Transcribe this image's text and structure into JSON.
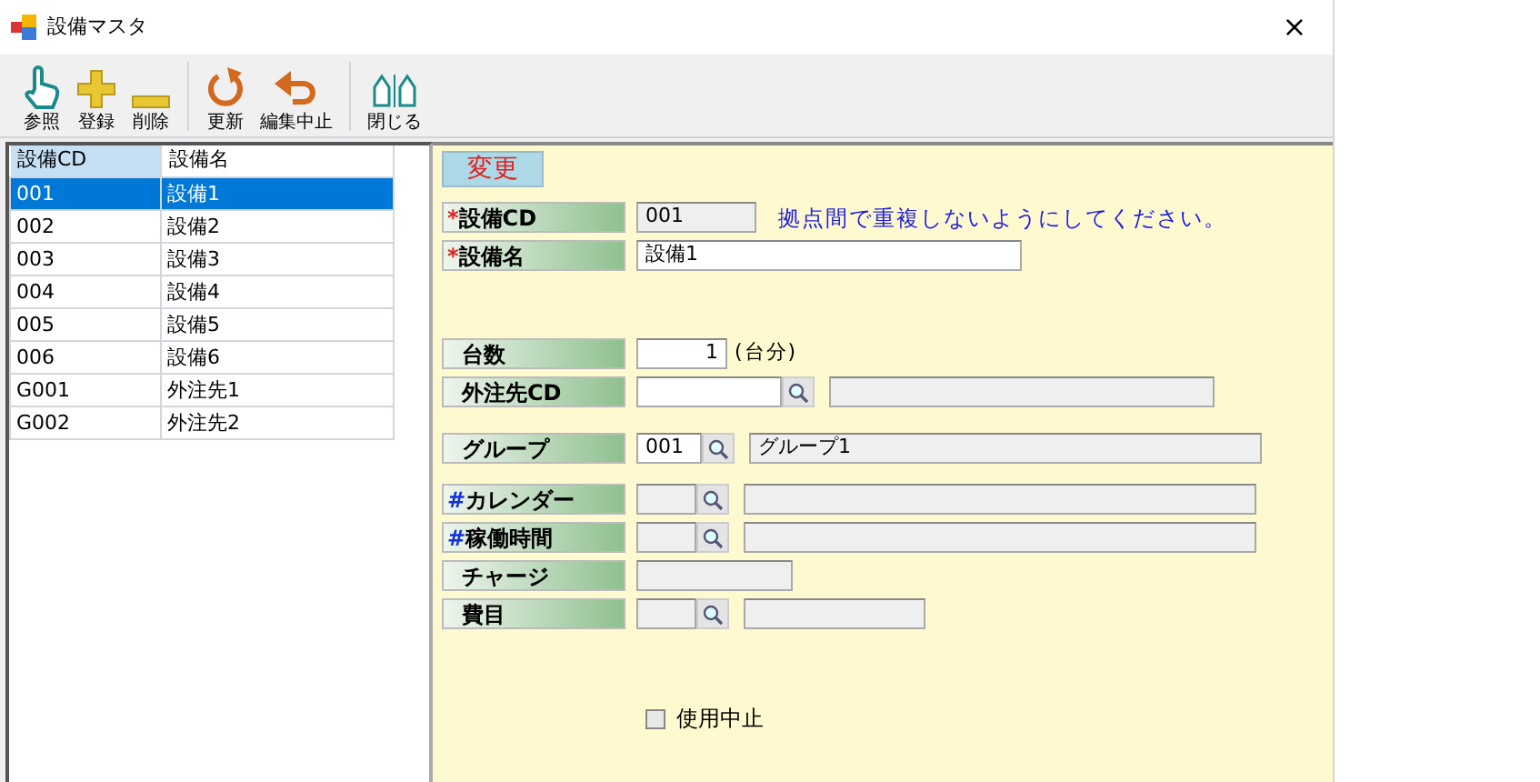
{
  "window": {
    "title": "設備マスタ",
    "close": "×"
  },
  "toolbar": {
    "groups": [
      [
        {
          "label": "参照"
        },
        {
          "label": "登録"
        },
        {
          "label": "削除"
        }
      ],
      [
        {
          "label": "更新"
        },
        {
          "label": "編集中止"
        }
      ],
      [
        {
          "label": "閉じる"
        }
      ]
    ]
  },
  "table": {
    "columns": [
      {
        "label": "設備CD",
        "selected": true
      },
      {
        "label": "設備名",
        "selected": false
      }
    ],
    "rows": [
      {
        "cells": [
          "001",
          "設備1"
        ],
        "selected": true
      },
      {
        "cells": [
          "002",
          "設備2"
        ],
        "selected": false
      },
      {
        "cells": [
          "003",
          "設備3"
        ],
        "selected": false
      },
      {
        "cells": [
          "004",
          "設備4"
        ],
        "selected": false
      },
      {
        "cells": [
          "005",
          "設備5"
        ],
        "selected": false
      },
      {
        "cells": [
          "006",
          "設備6"
        ],
        "selected": false
      },
      {
        "cells": [
          "G001",
          "外注先1"
        ],
        "selected": false
      },
      {
        "cells": [
          "G002",
          "外注先2"
        ],
        "selected": false
      }
    ]
  },
  "form": {
    "mode": "変更",
    "sections": [
      [
        {
          "kind": "code",
          "marker": "*",
          "color": "#e02020",
          "label": "設備CD",
          "value": "001",
          "enabled": false,
          "note": "拠点間で重複しないようにしてください。"
        },
        {
          "kind": "text",
          "marker": "*",
          "color": "#e02020",
          "label": "設備名",
          "value": "設備1",
          "enabled": true
        }
      ],
      [
        {
          "kind": "count",
          "label": "台数",
          "value": "1",
          "enabled": true,
          "unit": "(台分)"
        },
        {
          "kind": "lookup",
          "label": "外注先CD",
          "enabled": true
        }
      ],
      [
        {
          "kind": "lookup",
          "label": "グループ",
          "value": "001",
          "enabled": true,
          "name": "グループ1"
        }
      ],
      [
        {
          "kind": "lookup",
          "marker": "#",
          "color": "#1030e0",
          "label": "カレンダー",
          "enabled": false
        },
        {
          "kind": "lookup",
          "marker": "#",
          "color": "#1030e0",
          "label": "稼働時間",
          "enabled": false
        },
        {
          "kind": "text",
          "label": "チャージ",
          "enabled": false
        },
        {
          "kind": "lookup",
          "label": "費目",
          "enabled": false
        }
      ]
    ],
    "checkbox": {
      "label": "使用中止",
      "checked": false
    }
  }
}
